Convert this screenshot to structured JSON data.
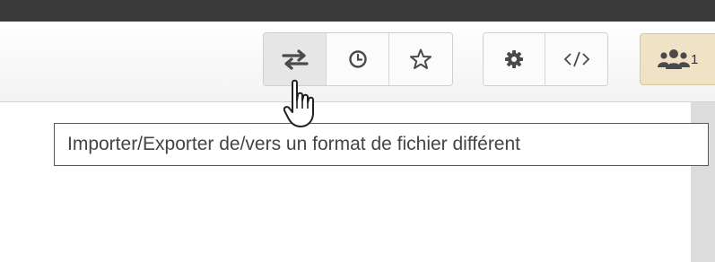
{
  "toolbar": {
    "history_group": {
      "buttons": [
        {
          "icon": "import-export-icon",
          "pressed": true
        },
        {
          "icon": "history-clock-icon"
        },
        {
          "icon": "star-icon"
        }
      ]
    },
    "settings_group": {
      "buttons": [
        {
          "icon": "gear-icon"
        },
        {
          "icon": "code-icon"
        }
      ]
    },
    "collaborators": {
      "icon": "users-icon",
      "count": "1",
      "color": "#f0e2c4"
    }
  },
  "tooltip": {
    "text": "Importer/Exporter de/vers un format de fichier différent"
  },
  "cursor": {
    "icon": "hand-pointer-icon"
  }
}
